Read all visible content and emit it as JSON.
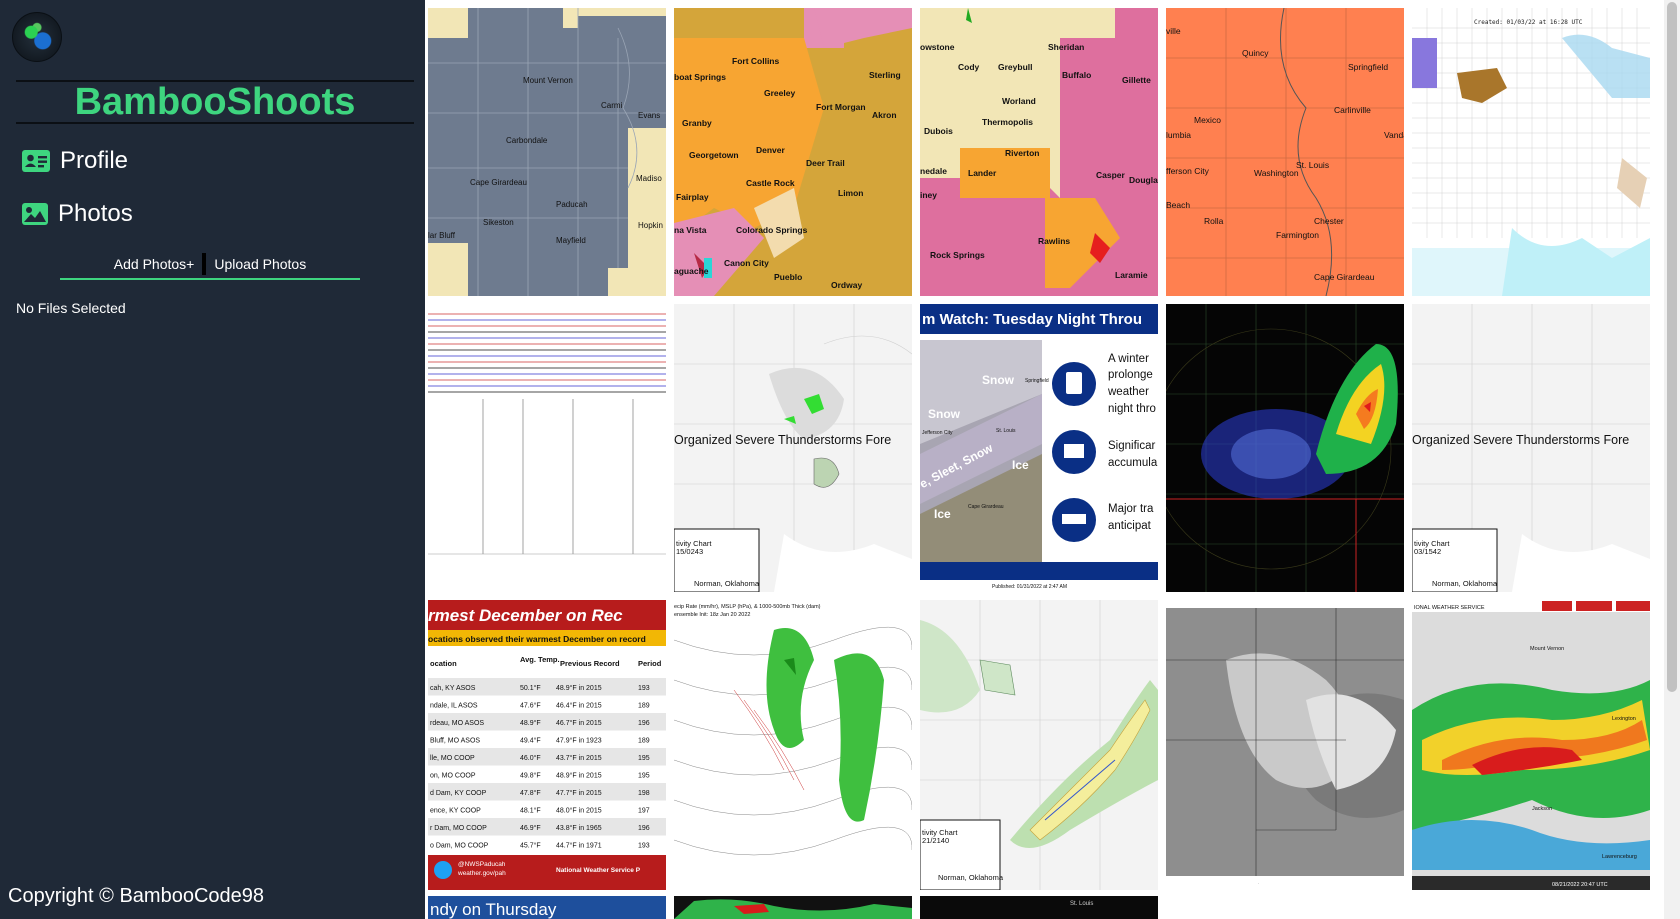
{
  "sidebar": {
    "brand": "BambooShoots",
    "nav": [
      {
        "label": "Profile",
        "icon": "id-card-icon"
      },
      {
        "label": "Photos",
        "icon": "image-icon"
      }
    ],
    "upload": {
      "add_label": "Add Photos+",
      "upload_label": "Upload Photos"
    },
    "status": "No Files Selected",
    "copyright": "Copyright © BambooCode98"
  },
  "colors": {
    "sidebar_bg": "#1f2937",
    "accent": "#3ed57f",
    "text": "#ffffff"
  },
  "gallery": {
    "photos": [
      {
        "kind": "map-warning-gray",
        "labels": [
          "Mount Vernon",
          "Carmi",
          "Evans",
          "Carbondale",
          "Madiso",
          "Cape Girardeau",
          "Paducah",
          "Hopkin",
          "Sikeston",
          "Mayfield",
          "lar Bluff"
        ]
      },
      {
        "kind": "map-warning-orange",
        "labels": [
          "Fort Collins",
          "boat Springs",
          "Greeley",
          "Sterling",
          "Fort Morgan",
          "Akron",
          "Granby",
          "Georgetown",
          "Denver",
          "Deer Trail",
          "Castle Rock",
          "Limon",
          "Fairplay",
          "na Vista",
          "Colorado Springs",
          "Canon City",
          "Pueblo",
          "Ordway",
          "aguache"
        ]
      },
      {
        "kind": "map-warning-wyoming",
        "labels": [
          "owstone",
          "Sheridan",
          "Cody",
          "Greybull",
          "Buffalo",
          "Gillette",
          "Worland",
          "Dubois",
          "Thermopolis",
          "Riverton",
          "nedale",
          "Lander",
          "Casper",
          "Dougla",
          "iney",
          "Rawlins",
          "Rock Springs",
          "Laramie"
        ]
      },
      {
        "kind": "map-warning-coral",
        "labels": [
          "ville",
          "Quincy",
          "Springfield",
          "Mexico",
          "Carlinville",
          "lumbia",
          "Vandal",
          "fferson City",
          "Washington",
          "St. Louis",
          "Beach",
          "Rolla",
          "Chester",
          "Farmington",
          "Cape Girardeau"
        ]
      },
      {
        "kind": "map-us-counties",
        "labels": [
          "Created: 01/03/22 at 16:28 UTC"
        ]
      },
      {
        "kind": "plot-lines",
        "labels": []
      },
      {
        "kind": "map-outlook",
        "labels": [
          "Organized Severe Thunderstorms Fore",
          "tivity Chart",
          "15/0243",
          "Norman, Oklahoma"
        ]
      },
      {
        "kind": "infographic-watch",
        "labels": [
          "m Watch: Tuesday Night Throu",
          "A winter",
          "prolonge",
          "weather",
          "night thro",
          "Significar",
          "accumula",
          "Major tra",
          "anticipat",
          "Snow",
          "Snow",
          "Ice",
          "Ice",
          "e, Sleet, Snow",
          "Jefferson City",
          "St. Louis",
          "Springfield",
          "Cape Girardeau",
          "Published: 01/31/2022 at 2:47 AM"
        ]
      },
      {
        "kind": "radar-dark",
        "labels": []
      },
      {
        "kind": "map-outlook",
        "labels": [
          "Organized Severe Thunderstorms Fore",
          "tivity Chart",
          "03/1542",
          "Norman, Oklahoma"
        ]
      },
      {
        "kind": "table-warmest",
        "labels": [
          "rmest December on Rec",
          "ocations observed their warmest December on record",
          "ocation",
          "Avg. Temp.",
          "Previous Record",
          "Period"
        ],
        "rows": [
          [
            "cah, KY ASOS",
            "50.1°F",
            "48.9°F in 2015",
            "193"
          ],
          [
            "ndale, IL ASOS",
            "47.6°F",
            "46.4°F in 2015",
            "189"
          ],
          [
            "rdeau, MO ASOS",
            "48.9°F",
            "46.7°F in 2015",
            "196"
          ],
          [
            "Bluff, MO ASOS",
            "49.4°F",
            "47.9°F in 1923",
            "189"
          ],
          [
            "lle, MO COOP",
            "46.0°F",
            "43.7°F in 2015",
            "195"
          ],
          [
            "on, MO COOP",
            "49.8°F",
            "48.9°F in 2015",
            "195"
          ],
          [
            "d Dam, KY COOP",
            "47.8°F",
            "47.7°F in 2015",
            "198"
          ],
          [
            "ence, KY COOP",
            "48.1°F",
            "48.0°F in 2015",
            "197"
          ],
          [
            "r Dam, MO COOP",
            "46.9°F",
            "43.8°F in 1965",
            "196"
          ],
          [
            "o Dam, MO COOP",
            "45.7°F",
            "44.7°F in 1971",
            "193"
          ]
        ],
        "footer": [
          "@NWSPaducah",
          "weather.gov/pah",
          "National Weather Service P"
        ]
      },
      {
        "kind": "model-precip",
        "labels": [
          "ecip Rate (mm/hr), MSLP (hPa), & 1000-500mb Thick (dam)",
          "ensemble Init: 18z Jan 20 2022",
          "valid at 00z Sun, Jan 30 2022"
        ]
      },
      {
        "kind": "map-outlook-green",
        "labels": [
          "tivity Chart",
          "21/2140",
          "Norman, Oklahoma"
        ]
      },
      {
        "kind": "satellite-gray",
        "labels": []
      },
      {
        "kind": "radar-light",
        "labels": [
          "IONAL WEATHER SERVICE",
          "Mount Vernon",
          "Lexington",
          "Jackson",
          "Lawrenceburg",
          "08/21/2022 20:47 UTC"
        ]
      },
      {
        "kind": "banner-blue",
        "labels": [
          "ndy on Thursday"
        ]
      },
      {
        "kind": "radar-green-strip",
        "labels": []
      },
      {
        "kind": "dark-strip",
        "labels": [
          "St. Louis"
        ]
      }
    ]
  }
}
